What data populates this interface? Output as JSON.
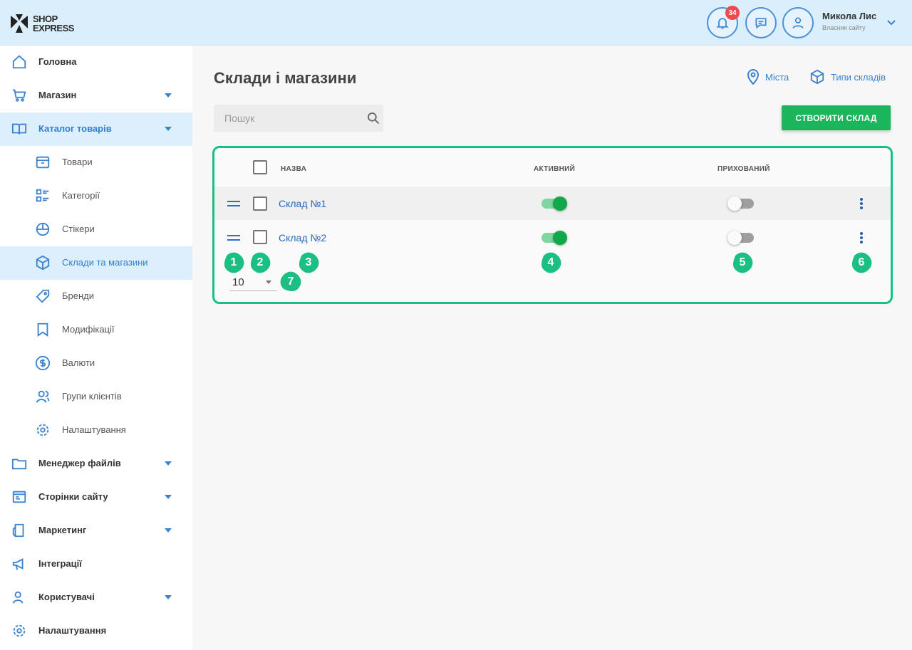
{
  "header": {
    "logo_text_line1": "SHOP",
    "logo_text_line2": "EXPRESS",
    "notifications_count": "34",
    "user_name": "Микола Лис",
    "user_role": "Власник сайту"
  },
  "sidebar": {
    "items": [
      {
        "label": "Головна",
        "icon": "home-icon"
      },
      {
        "label": "Магазин",
        "icon": "cart-icon"
      },
      {
        "label": "Каталог товарів",
        "icon": "book-icon"
      },
      {
        "label": "Товари",
        "icon": "box-icon"
      },
      {
        "label": "Категорії",
        "icon": "categories-icon"
      },
      {
        "label": "Стікери",
        "icon": "sticker-icon"
      },
      {
        "label": "Склади та магазини",
        "icon": "warehouse-icon"
      },
      {
        "label": "Бренди",
        "icon": "tag-icon"
      },
      {
        "label": "Модифікації",
        "icon": "bookmark-icon"
      },
      {
        "label": "Валюти",
        "icon": "dollar-icon"
      },
      {
        "label": "Групи клієнтів",
        "icon": "users-icon"
      },
      {
        "label": "Налаштування",
        "icon": "gear-icon"
      },
      {
        "label": "Менеджер файлів",
        "icon": "folder-icon"
      },
      {
        "label": "Сторінки сайту",
        "icon": "page-icon"
      },
      {
        "label": "Маркетинг",
        "icon": "marketing-icon"
      },
      {
        "label": "Інтеграції",
        "icon": "megaphone-icon"
      },
      {
        "label": "Користувачі",
        "icon": "user-icon"
      },
      {
        "label": "Налаштування",
        "icon": "gear-icon"
      }
    ]
  },
  "main": {
    "title": "Склади і магазини",
    "link_cities": "Міста",
    "link_types": "Типи складів",
    "search_placeholder": "Пошук",
    "create_button": "СТВОРИТИ СКЛАД",
    "columns": {
      "name": "НАЗВА",
      "active": "АКТИВНИЙ",
      "hidden": "ПРИХОВАНИЙ"
    },
    "rows": [
      {
        "name": "Склад №1",
        "active": true,
        "hidden": false
      },
      {
        "name": "Склад №2",
        "active": true,
        "hidden": false
      }
    ],
    "per_page": "10"
  },
  "markers": [
    "1",
    "2",
    "3",
    "4",
    "5",
    "6",
    "7"
  ],
  "colors": {
    "accent": "#3b82d0",
    "primary_button": "#1bb55c",
    "marker": "#1bbf84",
    "toggle_on": "#11a84b"
  }
}
